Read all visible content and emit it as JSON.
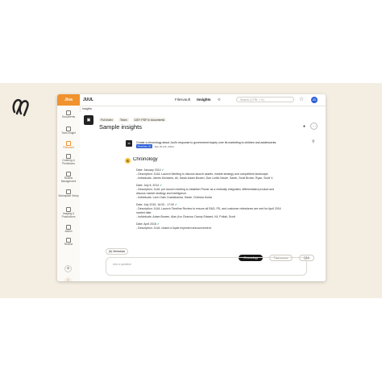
{
  "app": {
    "brand": "Jiva",
    "workspace": "JUUL",
    "nav": [
      "Filesvault",
      "Insights"
    ],
    "active_nav": "Insights",
    "search_placeholder": "Search (CTRL + K)",
    "avatar": "JD",
    "subnav": "Insights"
  },
  "sidebar": {
    "items": [
      {
        "label": "Documents",
        "icon": "document-icon"
      },
      {
        "label": "Tools Insight",
        "icon": "tools-icon"
      },
      {
        "label": "Filesvault",
        "icon": "folder-icon"
      },
      {
        "label": "Ordering & Predictions",
        "icon": "chart-icon"
      },
      {
        "label": "Review Management",
        "icon": "review-icon"
      },
      {
        "label": "Workspace Setup",
        "icon": "setup-icon"
      },
      {
        "label": "Imaging & Productions",
        "icon": "image-icon"
      },
      {
        "label": "Admin",
        "icon": "admin-icon"
      },
      {
        "label": "Review",
        "icon": "review2-icon"
      }
    ],
    "active_index": 2
  },
  "insight": {
    "chips": [
      "Full index",
      "Team",
      "120+ PDF in documents"
    ],
    "title": "Sample insights",
    "message": "Create a chronology about Juul's response to government inquiry over its marketing to children and adolescents.",
    "message_tag": "Metadata (5)",
    "message_date": "Mar 29 (26, 2024)",
    "answer_title": "Chronology",
    "entries": [
      {
        "date": "Date: January 2014",
        "lines": [
          "- Description: JUUL Launch Meeting to discuss launch assets, market strategy and competitive landscape.",
          "- Individuals: James Monsees, Ali, Sarah Adam Bowen, Dan Lorillo Nicole, Sarah, Scott Brown, Ryan, Scott V."
        ]
      },
      {
        "date": "Date: July 8, 2014",
        "lines": [
          "- Description: JUUL pre launch meeting to establish Pioner as a vertically integrated, differentiated product and",
          "  discuss market strategy and intelligence.",
          "- Individuals: Leon Gato Cuadabasha, Sarah, Chelsea Kuida"
        ]
      },
      {
        "date": "Date: July 2015, 16:00 - 17:00",
        "lines": [
          "- Description: JUUL Launch Timeline Review to ensure all R&D, PD, and customer milestones are met for April 2016",
          "  market date.",
          "- Individuals: Adam Bowen, Alan (Ivn Chanow, Danny Edward, Kit, Pollak, Scott"
        ]
      },
      {
        "date": "Date: April 2016",
        "lines": [
          "- Description: JUUL closed a liquid expected announcement."
        ]
      }
    ],
    "metadata_button": "(6) Metadata",
    "pills": [
      "Chronology",
      "Fact memo",
      "Q&A"
    ],
    "active_pill": "Chronology",
    "ask_placeholder": "Ask a question"
  }
}
